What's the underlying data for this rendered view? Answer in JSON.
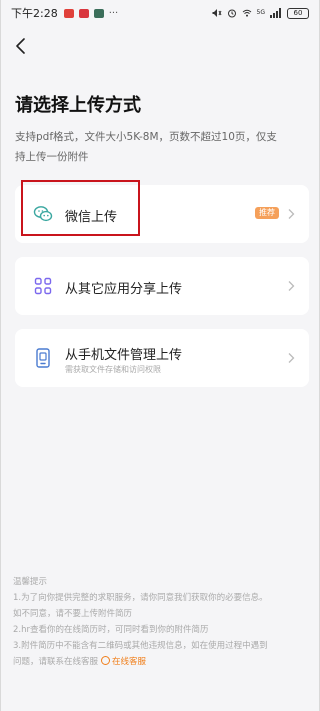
{
  "status_bar": {
    "time": "下午2:28",
    "signal_label": "5G",
    "battery": "60"
  },
  "header": {
    "back_label": "<",
    "title": "请选择上传方式",
    "subtitle_line1": "支持pdf格式，文件大小5K-8M，页数不超过10页，仅支",
    "subtitle_line2": "持上传一份附件"
  },
  "options": [
    {
      "label": "微信上传",
      "badge": "推荐",
      "icon": "wechat-icon"
    },
    {
      "label": "从其它应用分享上传",
      "icon": "apps-icon"
    },
    {
      "label": "从手机文件管理上传",
      "hint": "需获取文件存储和访问权限",
      "icon": "phone-icon"
    }
  ],
  "tips": {
    "heading": "温馨提示",
    "line1": "1.为了向你提供完整的求职服务，请你同意我们获取你的必要信息。",
    "line2": "如不同意，请不要上传附件简历",
    "line3": "2.hr查看你的在线简历时，可同时看到你的附件简历",
    "line4": "3.附件简历中不能含有二维码或其他违规信息，如在使用过程中遇到",
    "line5": "问题，请联系在线客服",
    "service_link": "在线客服"
  },
  "colors": {
    "accent": "#f07f1b",
    "badge": "#f5a05a",
    "highlight": "#c9141c",
    "icon_purple": "#7b68ee",
    "icon_teal": "#3aa7a0",
    "icon_blue": "#4a7bd0"
  }
}
